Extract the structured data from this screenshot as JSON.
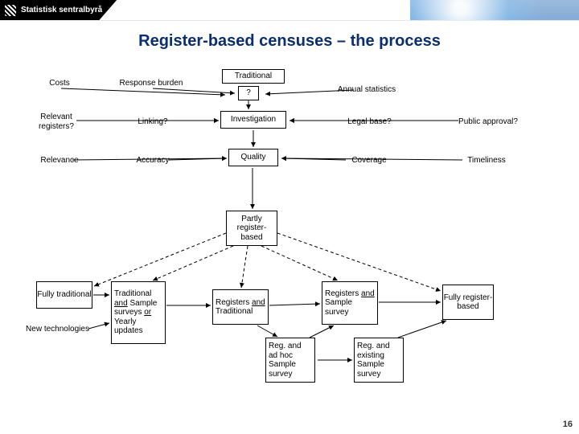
{
  "brand": "Statistisk sentralbyrå",
  "title": "Register-based censuses – the process",
  "nodes": {
    "costs": "Costs",
    "response_burden": "Response burden",
    "traditional": "Traditional",
    "question": "?",
    "annual_stats": "Annual statistics",
    "relevant_registers": "Relevant registers?",
    "linking": "Linking?",
    "investigation": "Investigation",
    "legal_base": "Legal base?",
    "public_approval": "Public approval?",
    "relevance": "Relevance",
    "accuracy": "Accuracy",
    "quality": "Quality",
    "coverage": "Coverage",
    "timeliness": "Timeliness",
    "partly": "Partly register-based",
    "fully_traditional": "Fully traditional",
    "trad_sample": "Traditional and Sample surveys or Yearly updates",
    "new_tech": "New technologies",
    "reg_and_trad": "Registers and Traditional",
    "reg_and_sample": "Registers and Sample survey",
    "fully_reg": "Fully register-based",
    "reg_adhoc": "Reg. and ad hoc Sample survey",
    "reg_existing": "Reg. and existing Sample survey"
  },
  "page_number": "16"
}
